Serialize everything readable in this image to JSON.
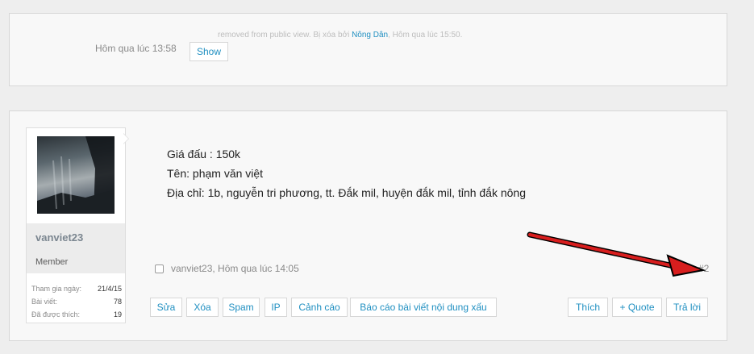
{
  "deleted_post": {
    "time": "Hôm qua lúc 13:58",
    "show_label": "Show",
    "notice_prefix": "removed from public view. Bị xóa bởi",
    "deleted_by": "Nông Dân",
    "notice_suffix": ", Hôm qua lúc 15:50."
  },
  "user": {
    "name": "vanviet23",
    "title": "Member",
    "stats": [
      {
        "label": "Tham gia ngày:",
        "value": "21/4/15"
      },
      {
        "label": "Bài viết:",
        "value": "78"
      },
      {
        "label": "Đã được thích:",
        "value": "19"
      }
    ]
  },
  "post": {
    "lines": [
      "Giá đấu : 150k",
      "Tên: phạm văn việt",
      "Địa chỉ: 1b, nguyễn tri phương, tt. Đắk mil, huyện đắk mil, tỉnh đắk nông"
    ],
    "meta": "vanviet23, Hôm qua lúc 14:05",
    "number": "#2"
  },
  "actions": {
    "left": [
      "Sửa",
      "Xóa",
      "Spam",
      "IP",
      "Cảnh cáo",
      "Báo cáo bài viết nội dung xấu"
    ],
    "right": [
      "Thích",
      "+ Quote",
      "Trả lời"
    ]
  },
  "colors": {
    "link": "#1f8fc1",
    "annotation_arrow": "#d81e1e"
  },
  "icons": {
    "arrow": "red-arrow-icon",
    "checkbox": "checkbox-icon"
  }
}
